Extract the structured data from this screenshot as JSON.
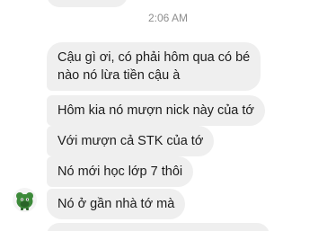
{
  "timestamp": "2:06 AM",
  "messages": [
    {
      "lines": [
        "Cậu gì ơi, có phải hôm qua có bé",
        "nào nó lừa tiền cậu à"
      ]
    },
    {
      "lines": [
        "Hôm kia nó mượn nick này của tớ"
      ]
    },
    {
      "lines": [
        "Với mượn cả STK của tớ"
      ]
    },
    {
      "lines": [
        "Nó mới học lớp 7 thôi"
      ]
    },
    {
      "lines": [
        "Nó ở gần nhà tớ mà"
      ]
    }
  ],
  "avatar": {
    "icon": "cartoon-avatar-icon",
    "colors": {
      "body": "#3d8a3a",
      "shade": "#2a6428"
    }
  },
  "colors": {
    "bubble": "#efefef",
    "text": "#1c1c1c",
    "timestamp": "#8e8e8e"
  }
}
